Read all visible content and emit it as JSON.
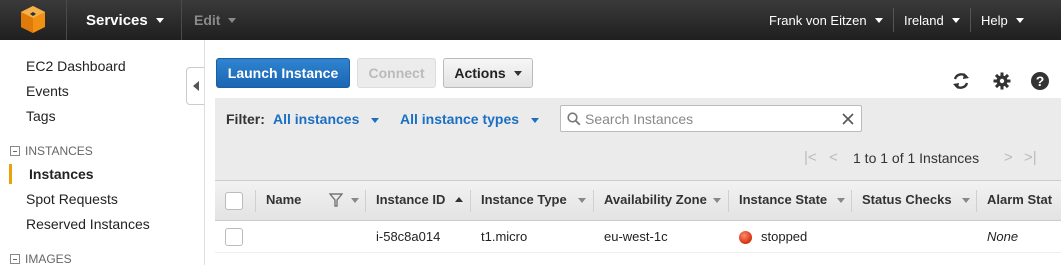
{
  "topbar": {
    "services_label": "Services",
    "edit_label": "Edit",
    "user_label": "Frank von Eitzen",
    "region_label": "Ireland",
    "help_label": "Help"
  },
  "sidebar": {
    "items": [
      {
        "label": "EC2 Dashboard"
      },
      {
        "label": "Events"
      },
      {
        "label": "Tags"
      }
    ],
    "sections": [
      {
        "title": "INSTANCES",
        "items": [
          {
            "label": "Instances",
            "active": true
          },
          {
            "label": "Spot Requests"
          },
          {
            "label": "Reserved Instances"
          }
        ]
      },
      {
        "title": "IMAGES"
      }
    ]
  },
  "toolbar": {
    "launch_label": "Launch Instance",
    "connect_label": "Connect",
    "actions_label": "Actions",
    "icons": [
      "refresh-icon",
      "gear-icon",
      "help-icon"
    ]
  },
  "filter": {
    "label": "Filter:",
    "instances_dropdown": "All instances",
    "types_dropdown": "All instance types",
    "search_placeholder": "Search Instances",
    "pagination_text": "1 to 1 of 1 Instances"
  },
  "table": {
    "columns": [
      {
        "label": "Name"
      },
      {
        "label": "Instance ID",
        "sorted": "asc"
      },
      {
        "label": "Instance Type"
      },
      {
        "label": "Availability Zone"
      },
      {
        "label": "Instance State"
      },
      {
        "label": "Status Checks"
      },
      {
        "label": "Alarm Stat"
      }
    ],
    "rows": [
      {
        "name": "",
        "instance_id": "i-58c8a014",
        "instance_type": "t1.micro",
        "availability_zone": "eu-west-1c",
        "instance_state": "stopped",
        "status_checks": "",
        "alarm_status": "None"
      }
    ]
  },
  "colors": {
    "topbar": "#232f3e",
    "primary": "#1a66b3",
    "link": "#1a6fc4",
    "active_accent": "#e8a20e",
    "stopped": "#d2300f"
  }
}
